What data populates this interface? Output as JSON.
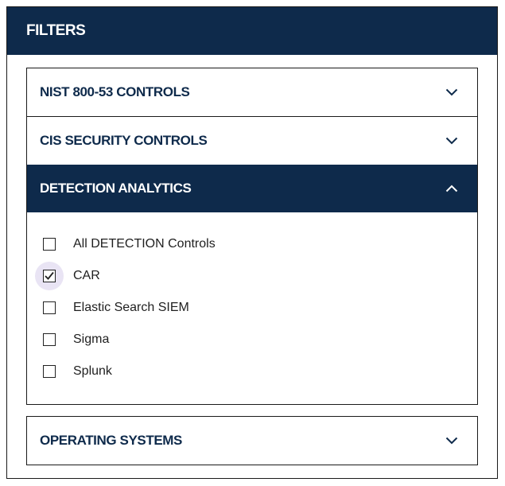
{
  "panel": {
    "title": "FILTERS"
  },
  "sections": [
    {
      "label": "NIST 800-53 CONTROLS",
      "expanded": false,
      "icon": "chevron-down-icon"
    },
    {
      "label": "CIS SECURITY CONTROLS",
      "expanded": false,
      "icon": "chevron-down-icon"
    },
    {
      "label": "DETECTION ANALYTICS",
      "expanded": true,
      "icon": "chevron-up-icon"
    },
    {
      "label": "OPERATING SYSTEMS",
      "expanded": false,
      "icon": "chevron-down-icon"
    }
  ],
  "detection_options": [
    {
      "label": "All DETECTION Controls",
      "checked": false
    },
    {
      "label": "CAR",
      "checked": true,
      "focused": true
    },
    {
      "label": "Elastic Search SIEM",
      "checked": false
    },
    {
      "label": "Sigma",
      "checked": false
    },
    {
      "label": "Splunk",
      "checked": false
    }
  ],
  "colors": {
    "header_bg": "#0e2a4b",
    "header_text": "#ffffff",
    "focus_halo": "#e9e4f4"
  }
}
